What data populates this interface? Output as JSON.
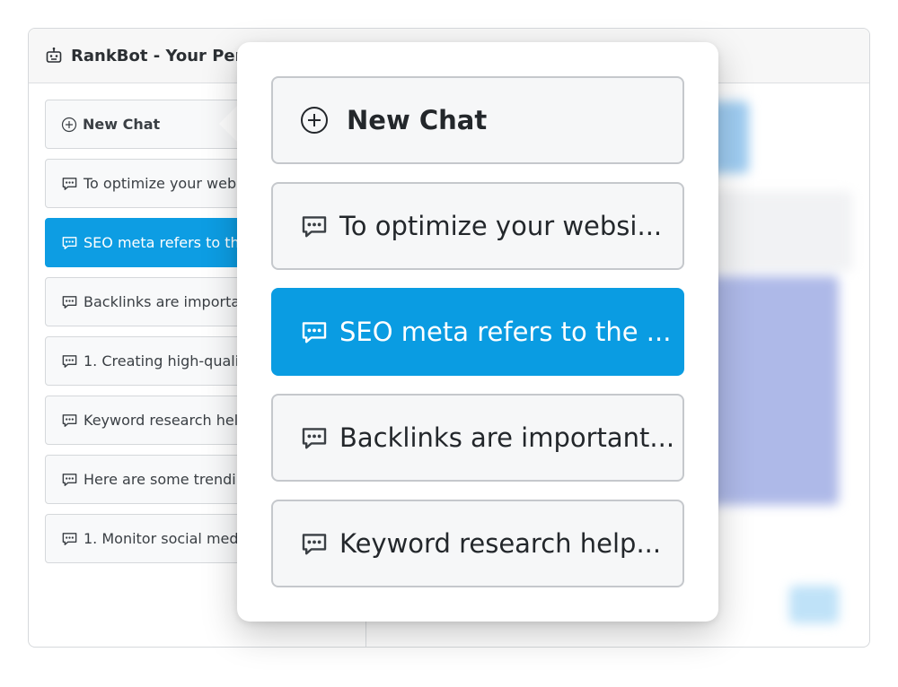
{
  "app": {
    "title": "RankBot - Your Perso"
  },
  "sidebar": {
    "new_chat_label": "New Chat",
    "items": [
      {
        "label": "To optimize your webs",
        "active": false
      },
      {
        "label": "SEO meta refers to the",
        "active": true
      },
      {
        "label": "Backlinks are importan",
        "active": false
      },
      {
        "label": "1. Creating high-qualit",
        "active": false
      },
      {
        "label": "Keyword research help",
        "active": false
      },
      {
        "label": "Here are some trendin",
        "active": false
      },
      {
        "label": "1. Monitor social medi",
        "active": false
      }
    ]
  },
  "popover": {
    "new_chat_label": "New Chat",
    "items": [
      {
        "label": "To optimize your websi...",
        "active": false
      },
      {
        "label": "SEO meta refers to the ...",
        "active": true
      },
      {
        "label": "Backlinks are important...",
        "active": false
      },
      {
        "label": "Keyword research help...",
        "active": false
      }
    ]
  },
  "icons": {
    "new_chat": "plus-circle-icon",
    "chat_item": "chat-dots-icon",
    "app": "robot-icon"
  },
  "colors": {
    "accent": "#0a9ce2",
    "item_bg": "#f6f7f8",
    "border": "#c5c8cc"
  }
}
